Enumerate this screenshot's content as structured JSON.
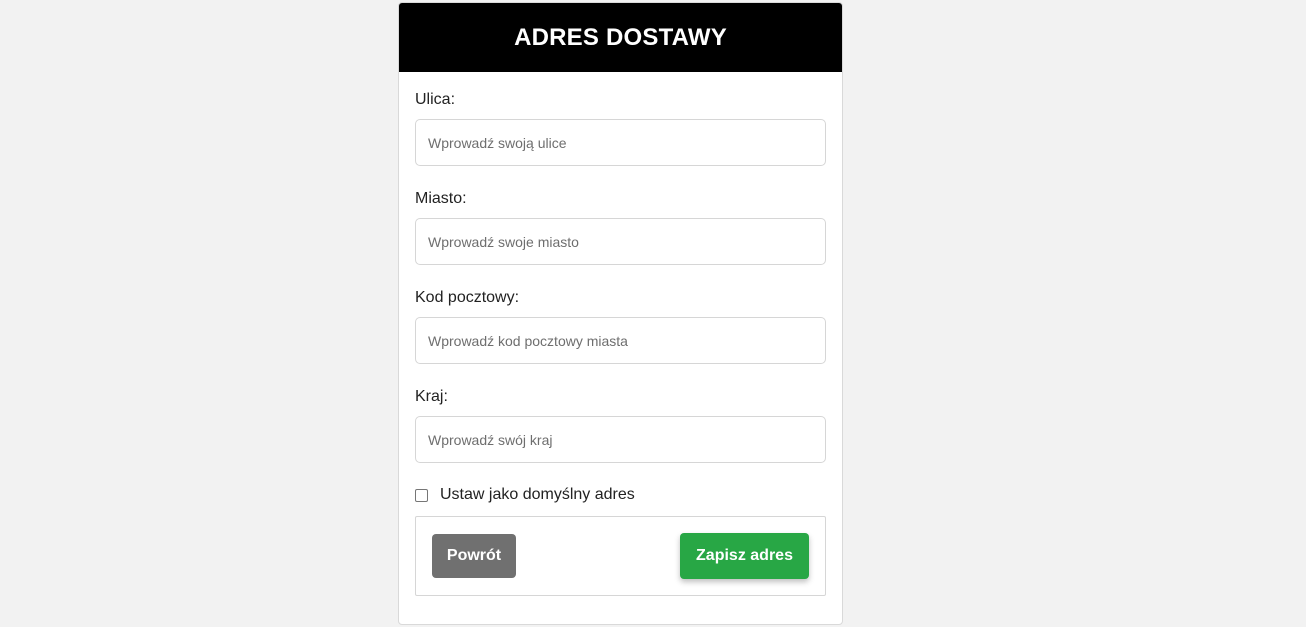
{
  "header": {
    "title": "ADRES DOSTAWY"
  },
  "form": {
    "fields": [
      {
        "label": "Ulica:",
        "placeholder": "Wprowadź swoją ulice",
        "value": ""
      },
      {
        "label": "Miasto:",
        "placeholder": "Wprowadź swoje miasto",
        "value": ""
      },
      {
        "label": "Kod pocztowy:",
        "placeholder": "Wprowadź kod pocztowy miasta",
        "value": ""
      },
      {
        "label": "Kraj:",
        "placeholder": "Wprowadź swój kraj",
        "value": ""
      }
    ],
    "default_checkbox": {
      "label": "Ustaw jako domyślny adres",
      "checked": false
    }
  },
  "actions": {
    "back_label": "Powrót",
    "save_label": "Zapisz adres"
  },
  "colors": {
    "header_bg": "#000000",
    "save_button": "#28a745",
    "back_button": "#707070",
    "page_bg": "#f2f2f2"
  }
}
